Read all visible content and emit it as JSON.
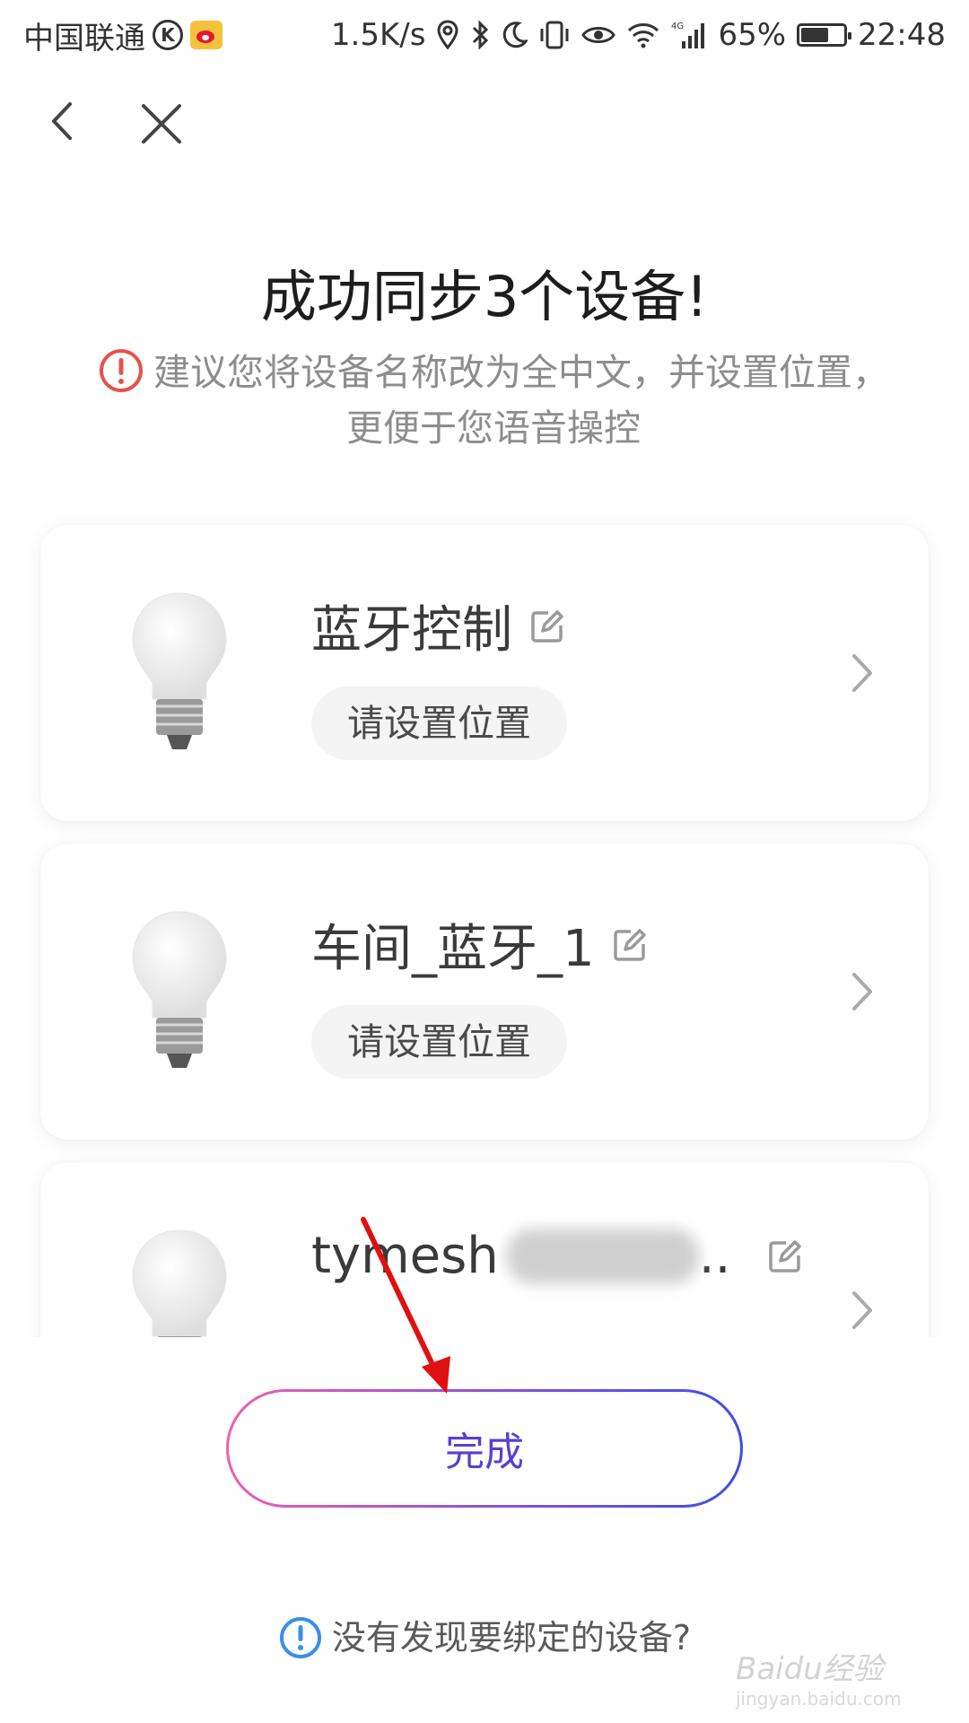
{
  "status_bar": {
    "carrier": "中国联通",
    "speed": "1.5K/s",
    "network": "4G",
    "battery": "65%",
    "battery_level": 0.65,
    "time": "22:48"
  },
  "title": "成功同步3个设备!",
  "notice": "建议您将设备名称改为全中文，并设置位置，更便于您语音操控",
  "devices": [
    {
      "name": "蓝牙控制",
      "location_label": "请设置位置"
    },
    {
      "name": "车间_蓝牙_1",
      "location_label": "请设置位置"
    },
    {
      "name_prefix": "tymesh",
      "name_suffix": ".."
    }
  ],
  "done_label": "完成",
  "help_text": "没有发现要绑定的设备?",
  "watermark": {
    "main": "Baidu经验",
    "sub": "jingyan.baidu.com"
  },
  "colors": {
    "accent": "#5b3fd0",
    "gradient_start": "#ef5fae",
    "gradient_end": "#3d4fe0",
    "warning": "#e5534b",
    "info": "#3a8ee6",
    "annotation_arrow": "#e01010"
  },
  "icons": [
    "back-arrow-icon",
    "close-icon",
    "warning-icon",
    "edit-icon",
    "chevron-right-icon",
    "info-icon",
    "bulb-icon"
  ]
}
